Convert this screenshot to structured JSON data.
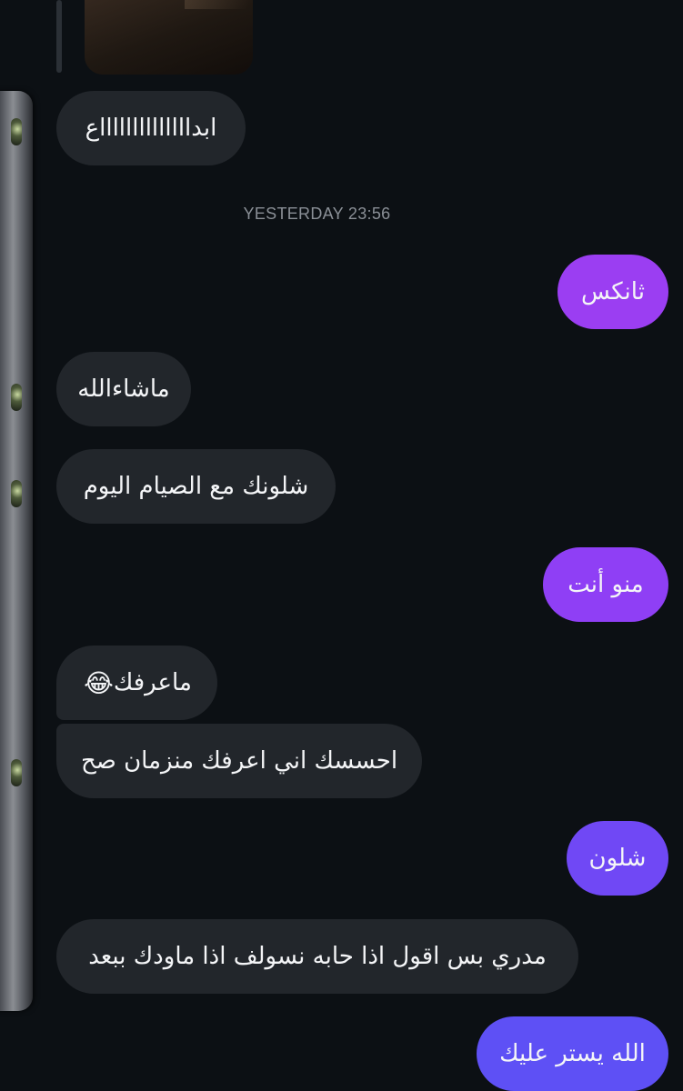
{
  "thread": {
    "media_alt": "shared photo"
  },
  "timestamp": "YESTERDAY 23:56",
  "messages": [
    {
      "id": 0,
      "side": "received",
      "text": "ابدااااااااااااااع",
      "emoji": ""
    },
    {
      "id": 1,
      "side": "sent",
      "text": "ثانكس",
      "emoji": "",
      "color": "#9b3ef2"
    },
    {
      "id": 2,
      "side": "received",
      "text": "ماشاءالله",
      "emoji": ""
    },
    {
      "id": 3,
      "side": "received",
      "text": "شلونك مع الصيام اليوم",
      "emoji": ""
    },
    {
      "id": 4,
      "side": "sent",
      "text": "منو أنت",
      "emoji": "",
      "color": "#8f3ff5"
    },
    {
      "id": 5,
      "side": "received",
      "text": "ماعرفك",
      "emoji": "😂"
    },
    {
      "id": 6,
      "side": "received",
      "text": "احسسك اني اعرفك منزمان صح",
      "emoji": ""
    },
    {
      "id": 7,
      "side": "sent",
      "text": "شلون",
      "emoji": "",
      "color": "#7048f5"
    },
    {
      "id": 8,
      "side": "received",
      "text": "مدري بس اقول اذا حابه نسولف اذا ماودك ببعد",
      "emoji": ""
    },
    {
      "id": 9,
      "side": "sent",
      "text": "الله يستر عليك",
      "emoji": "",
      "color": "#5e50f5"
    }
  ]
}
